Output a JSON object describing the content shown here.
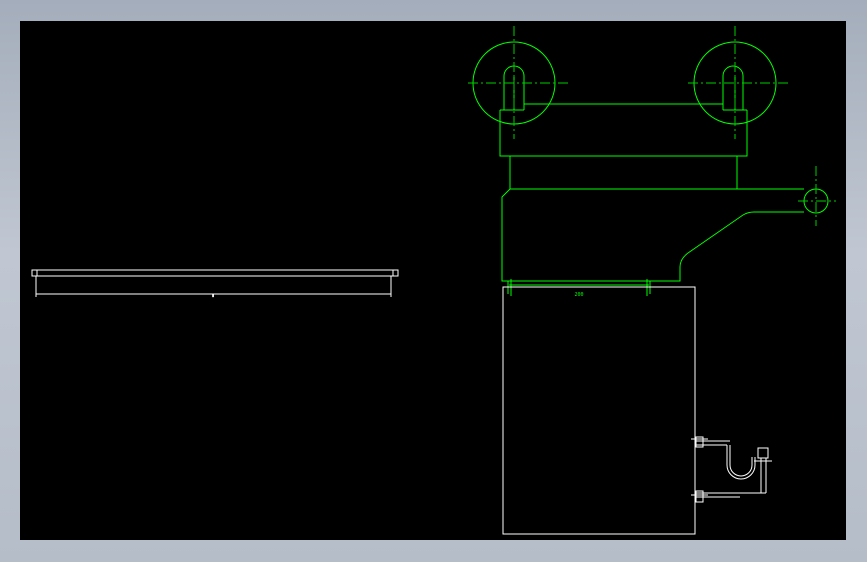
{
  "canvas": {
    "background": "#000000",
    "frame_color": "#b3bcc8"
  },
  "colors": {
    "geometry_green": "#00ff00",
    "geometry_white": "#ffffff",
    "centerline_green": "#00cc00"
  },
  "left_view": {
    "dimension_label": "▮"
  },
  "right_view": {
    "dimension_label": "200"
  }
}
